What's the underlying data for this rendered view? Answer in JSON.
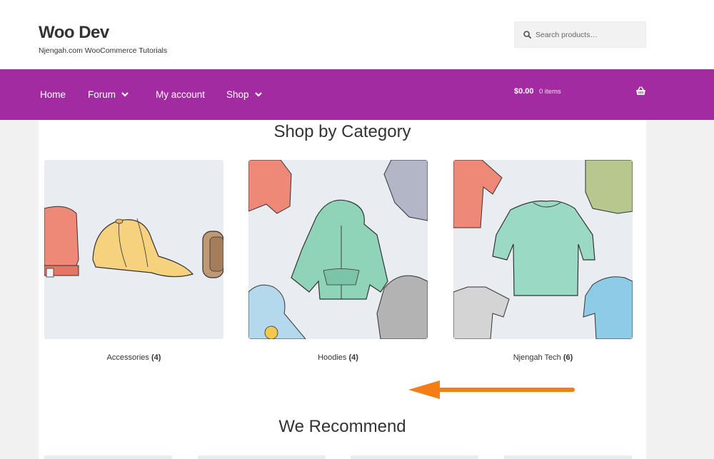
{
  "header": {
    "site_title": "Woo Dev",
    "tagline": "Njengah.com WooCommerce Tutorials",
    "search_placeholder": "Search products…"
  },
  "nav": {
    "items": [
      {
        "label": "Home",
        "has_dropdown": false
      },
      {
        "label": "Forum",
        "has_dropdown": true
      },
      {
        "label": "My account",
        "has_dropdown": false
      },
      {
        "label": "Shop",
        "has_dropdown": true
      }
    ],
    "cart": {
      "amount": "$0.00",
      "count": "0 items",
      "icon": "basket-icon"
    }
  },
  "category_section": {
    "title": "Shop by Category",
    "categories": [
      {
        "name": "Accessories",
        "count": "(4)"
      },
      {
        "name": "Hoodies",
        "count": "(4)"
      },
      {
        "name": "Njengah Tech",
        "count": "(6)"
      }
    ]
  },
  "recommend_section": {
    "title": "We Recommend"
  },
  "colors": {
    "nav_bg": "#a22ba2",
    "arrow": "#f47d16",
    "image_bg": "#e9edf2"
  }
}
